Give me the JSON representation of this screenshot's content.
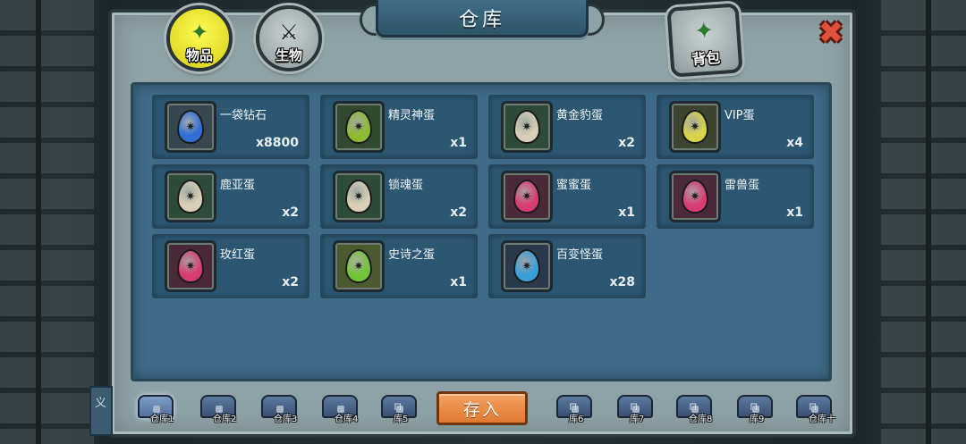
{
  "title": "仓库",
  "tabs": [
    {
      "label": "物品",
      "icon": "item-icon",
      "active": true
    },
    {
      "label": "生物",
      "icon": "creature-icon",
      "active": false
    }
  ],
  "bag": {
    "label": "背包",
    "icon": "backpack-icon"
  },
  "close": {
    "icon": "close-icon",
    "glyph": "✖"
  },
  "items": [
    {
      "name": "一袋钻石",
      "qty": "x8800",
      "icon": "diamond-bag-icon",
      "color": "#2f6fd6",
      "frame": "#36474f"
    },
    {
      "name": "精灵神蛋",
      "qty": "x1",
      "icon": "elf-egg-icon",
      "color": "#8dbb2f",
      "frame": "#2f4a2e"
    },
    {
      "name": "黄金豹蛋",
      "qty": "x2",
      "icon": "golden-leopard-egg-icon",
      "color": "#d8cfb6",
      "frame": "#2e4a38"
    },
    {
      "name": "VIP蛋",
      "qty": "x4",
      "icon": "vip-egg-icon",
      "color": "#d9d34a",
      "frame": "#3d4430"
    },
    {
      "name": "鹿亚蛋",
      "qty": "x2",
      "icon": "luya-egg-icon",
      "color": "#d8cfb6",
      "frame": "#2e4a38"
    },
    {
      "name": "锁魂蛋",
      "qty": "x2",
      "icon": "soul-lock-egg-icon",
      "color": "#d8cfb6",
      "frame": "#2e4a38"
    },
    {
      "name": "蜜蜜蛋",
      "qty": "x1",
      "icon": "honey-egg-icon",
      "color": "#d83c72",
      "frame": "#4a2a3a"
    },
    {
      "name": "雷兽蛋",
      "qty": "x1",
      "icon": "thunder-beast-egg-icon",
      "color": "#d83c72",
      "frame": "#4a2a3a"
    },
    {
      "name": "玫红蛋",
      "qty": "x2",
      "icon": "rose-egg-icon",
      "color": "#d83c72",
      "frame": "#4a2a3a"
    },
    {
      "name": "史诗之蛋",
      "qty": "x1",
      "icon": "epic-egg-icon",
      "color": "#73c43b",
      "frame": "#4a5a2e"
    },
    {
      "name": "百变怪蛋",
      "qty": "x28",
      "icon": "shapeshifter-egg-icon",
      "color": "#3aa0d8",
      "frame": "#2a3a4a"
    }
  ],
  "deposit_label": "存入",
  "warehouses": [
    {
      "label": "仓库1",
      "active": true,
      "locked": false
    },
    {
      "label": "仓库2",
      "active": false,
      "locked": false
    },
    {
      "label": "仓库3",
      "active": false,
      "locked": false
    },
    {
      "label": "仓库4",
      "active": false,
      "locked": false
    },
    {
      "label": "库5",
      "active": false,
      "locked": true
    },
    {
      "label": "库6",
      "active": false,
      "locked": true
    },
    {
      "label": "库7",
      "active": false,
      "locked": true
    },
    {
      "label": "仓库8",
      "active": false,
      "locked": true
    },
    {
      "label": "库9",
      "active": false,
      "locked": true
    },
    {
      "label": "仓库十",
      "active": false,
      "locked": true
    }
  ],
  "side_tab_text": "义"
}
